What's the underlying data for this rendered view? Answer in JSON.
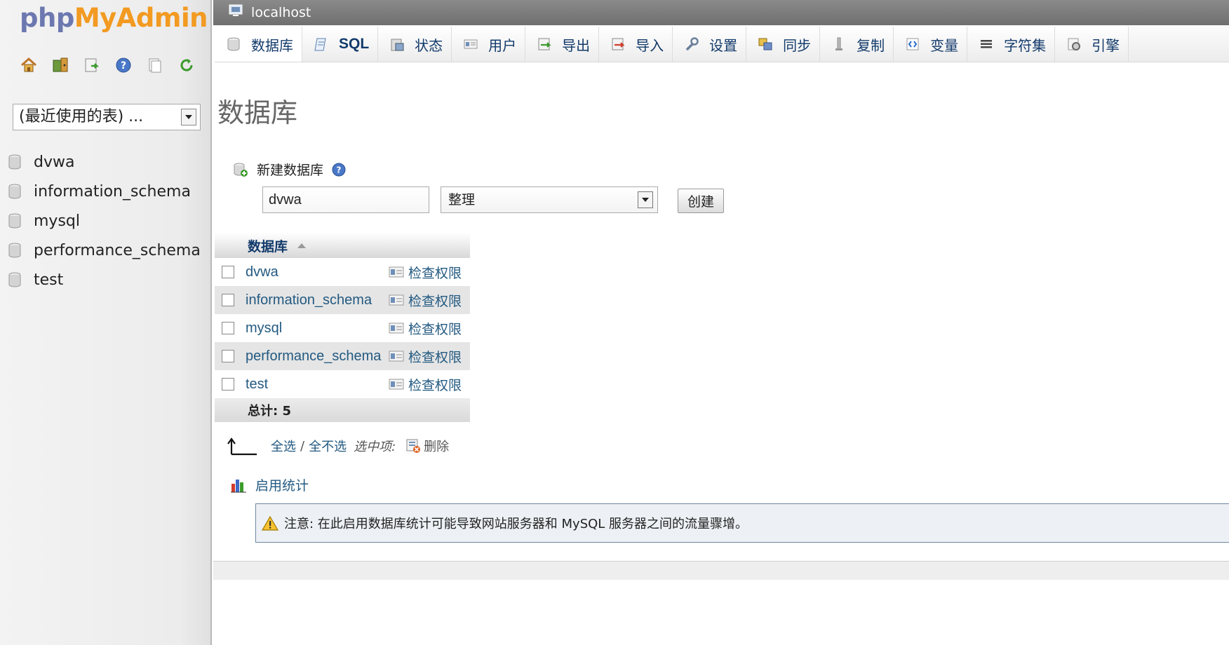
{
  "nav": {
    "logo": {
      "php": "php",
      "my": "My",
      "admin": "Admin"
    },
    "icons": [
      "home-icon",
      "exit-icon",
      "query-window-icon",
      "help-icon",
      "docs-icon",
      "reload-icon"
    ],
    "recent_tables": "(最近使用的表) ...",
    "databases": [
      "dvwa",
      "information_schema",
      "mysql",
      "performance_schema",
      "test"
    ]
  },
  "topbar": {
    "server": "localhost"
  },
  "tabs": [
    {
      "label": "数据库",
      "icon": "database-icon",
      "active": true
    },
    {
      "label": "SQL",
      "icon": "sql-icon"
    },
    {
      "label": "状态",
      "icon": "status-icon"
    },
    {
      "label": "用户",
      "icon": "users-icon"
    },
    {
      "label": "导出",
      "icon": "export-icon"
    },
    {
      "label": "导入",
      "icon": "import-icon"
    },
    {
      "label": "设置",
      "icon": "settings-icon"
    },
    {
      "label": "同步",
      "icon": "sync-icon"
    },
    {
      "label": "复制",
      "icon": "replication-icon"
    },
    {
      "label": "变量",
      "icon": "variables-icon"
    },
    {
      "label": "字符集",
      "icon": "charset-icon"
    },
    {
      "label": "引擎",
      "icon": "engines-icon"
    }
  ],
  "main": {
    "title": "数据库",
    "create": {
      "label": "新建数据库",
      "name_value": "dvwa",
      "collation_value": "整理",
      "button": "创建"
    },
    "table": {
      "header": "数据库",
      "rows": [
        {
          "name": "dvwa",
          "action": "检查权限"
        },
        {
          "name": "information_schema",
          "action": "检查权限"
        },
        {
          "name": "mysql",
          "action": "检查权限"
        },
        {
          "name": "performance_schema",
          "action": "检查权限"
        },
        {
          "name": "test",
          "action": "检查权限"
        }
      ],
      "total": "总计: 5"
    },
    "select_actions": {
      "check_all": "全选",
      "separator": "/",
      "uncheck_all": "全不选",
      "with_selected": "选中项:",
      "delete": "删除"
    },
    "stats_link": "启用统计",
    "notice": "注意: 在此启用数据库统计可能导致网站服务器和 MySQL 服务器之间的流量骤增。"
  },
  "colors": {
    "link": "#235a81",
    "topbar": "#7a7a7a",
    "logo_php": "#6c78af",
    "logo_my": "#f29a21"
  }
}
